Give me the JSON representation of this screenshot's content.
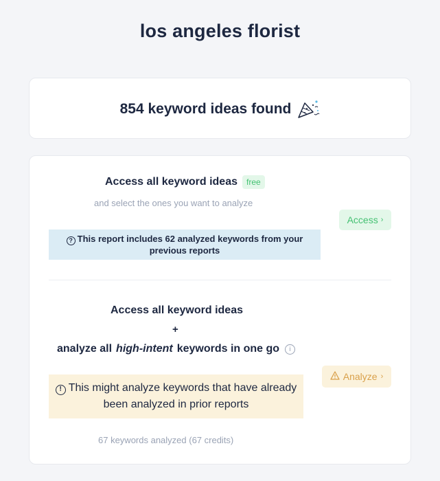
{
  "page": {
    "title": "los angeles florist"
  },
  "summary": {
    "text": "854 keyword ideas found",
    "icon": "party-popper-icon"
  },
  "free_access": {
    "title": "Access all keyword ideas",
    "badge": "free",
    "subtitle": "and select the ones you want to analyze",
    "info": "This report includes 62 analyzed keywords from your previous reports",
    "button_label": "Access",
    "button_chevron": "›",
    "accent": "#44c172"
  },
  "analyze": {
    "line1": "Access all keyword ideas",
    "plus": "+",
    "line2_prefix": "analyze all",
    "line2_emphasis": "high-intent",
    "line2_suffix": "keywords in one go",
    "warning": "This might analyze keywords that have already been analyzed in prior reports",
    "button_label": "Analyze",
    "button_chevron": "›",
    "credits": "67 keywords analyzed (67 credits)",
    "accent": "#d9a04a"
  }
}
